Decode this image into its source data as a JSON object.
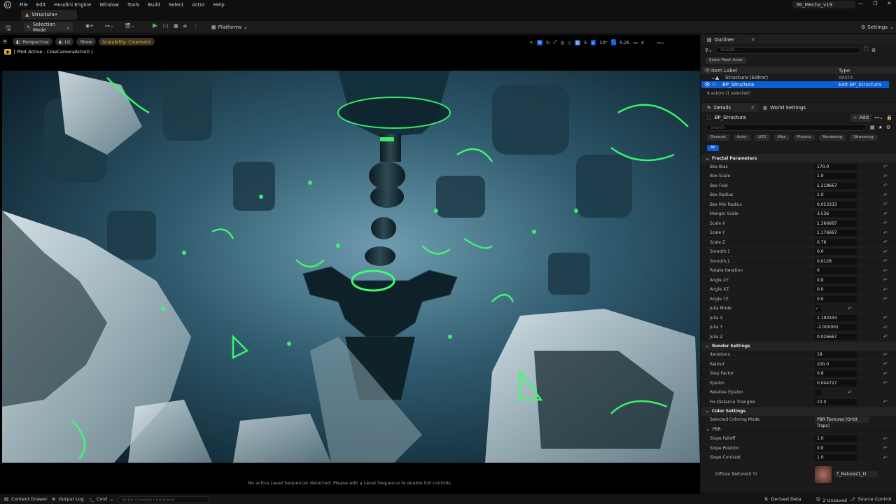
{
  "menu": [
    "File",
    "Edit",
    "Houdini Engine",
    "Window",
    "Tools",
    "Build",
    "Select",
    "Actor",
    "Help"
  ],
  "document_tab": "Structura•",
  "app_title": "MI_Mecha_v19",
  "toolbar": {
    "selection_mode": "Selection Mode",
    "platforms": "Platforms",
    "settings": "Settings"
  },
  "viewport": {
    "perspective": "Perspective",
    "lit": "Lit",
    "show": "Show",
    "scalability": "Scalability: Cinematic",
    "pilot": "[ Pilot Active - CineCameraActor0 ]",
    "grid_snap": "5",
    "rotate_snap": "10°",
    "scale_snap": "0.25",
    "camera_speed": "4",
    "sequencer_message": "No active Level Sequencer detected. Please edit a Level Sequence to enable full controls."
  },
  "outliner": {
    "title": "Outliner",
    "search_placeholder": "Search...",
    "filter_chip": "Static Mesh Actor",
    "col_label": "Item Label",
    "col_type": "Type",
    "rows": [
      {
        "label": "Structura (Editor)",
        "type": "World"
      },
      {
        "label": "BP_Structura",
        "type": "Edit BP_Structura"
      }
    ],
    "footer": "6 actors (1 selected)"
  },
  "details": {
    "tab_details": "Details",
    "tab_world": "World Settings",
    "actor": "BP_Structura",
    "add": "Add",
    "search_placeholder": "Search",
    "categories": [
      "General",
      "Actor",
      "LOD",
      "Misc",
      "Physics",
      "Rendering",
      "Streaming",
      "All"
    ],
    "fractal_title": "Fractal Parameters",
    "fractal": [
      {
        "label": "Box Bias",
        "value": "170.0"
      },
      {
        "label": "Box Scale",
        "value": "1.0"
      },
      {
        "label": "Box Fold",
        "value": "1.218667"
      },
      {
        "label": "Box Radius",
        "value": "1.0"
      },
      {
        "label": "Box Min Radius",
        "value": "0.053333"
      },
      {
        "label": "Menger Scale",
        "value": "3.536"
      },
      {
        "label": "Scale X",
        "value": "1.366667"
      },
      {
        "label": "Scale Y",
        "value": "1.176667"
      },
      {
        "label": "Scale Z",
        "value": "0.76"
      },
      {
        "label": "Smooth 1",
        "value": "0.0"
      },
      {
        "label": "Smooth 2",
        "value": "0.0128"
      },
      {
        "label": "Rotate Iteration",
        "value": "0"
      },
      {
        "label": "Angle XY",
        "value": "0.0"
      },
      {
        "label": "Angle XZ",
        "value": "0.0"
      },
      {
        "label": "Angle YZ",
        "value": "0.0"
      },
      {
        "label": "Julia Mode",
        "value": "✓"
      },
      {
        "label": "Julia X",
        "value": "1.193334"
      },
      {
        "label": "Julia Y",
        "value": "-2.000002"
      },
      {
        "label": "Julia Z",
        "value": "0.026667"
      }
    ],
    "render_title": "Render Settings",
    "render": [
      {
        "label": "Iterations",
        "value": "18"
      },
      {
        "label": "Bailout",
        "value": "200.0"
      },
      {
        "label": "Step Factor",
        "value": "0.8"
      },
      {
        "label": "Epsilon",
        "value": "0.044727"
      },
      {
        "label": "Relative Epsilon",
        "value": ""
      },
      {
        "label": "Fix Distance Triangles",
        "value": "10.0"
      }
    ],
    "color_title": "Color Settings",
    "coloring_label": "Selected Coloring Mode",
    "coloring_value": "PBR Textures (Orbit Traps)",
    "pbr_title": "PBR",
    "pbr": [
      {
        "label": "Slope Falloff",
        "value": "1.0"
      },
      {
        "label": "Slope Position",
        "value": "0.0"
      },
      {
        "label": "Slope Contrast",
        "value": "1.0"
      }
    ],
    "diffuse_label": "Diffuse Texture(X Y)",
    "diffuse_value": "T_Nature21_D"
  },
  "statusbar": {
    "content_drawer": "Content Drawer",
    "output_log": "Output Log",
    "cmd": "Cmd",
    "console_placeholder": "Enter Console Command",
    "derived_data": "Derived Data",
    "unsaved": "2 Unsaved",
    "source_control": "Source Control"
  },
  "colors": {
    "accent_green": "#39ff6a",
    "selection_blue": "#0a5ed6",
    "scalability_amber": "#e3b341"
  }
}
